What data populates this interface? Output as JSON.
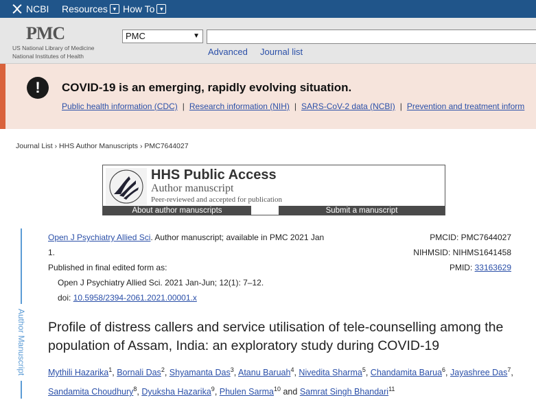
{
  "topbar": {
    "brand": "NCBI",
    "menu_resources": "Resources",
    "menu_howto": "How To"
  },
  "header": {
    "logo": "PMC",
    "nlm_line1": "US National Library of Medicine",
    "nlm_line2": "National Institutes of Health",
    "db_select": "PMC",
    "link_advanced": "Advanced",
    "link_journal_list": "Journal list"
  },
  "alert": {
    "message": "COVID-19 is an emerging, rapidly evolving situation.",
    "links": [
      "Public health information (CDC)",
      "Research information (NIH)",
      "SARS-CoV-2 data (NCBI)",
      "Prevention and treatment inform"
    ]
  },
  "breadcrumb": {
    "item1": "Journal List",
    "item2": "HHS Author Manuscripts",
    "item3": "PMC7644027",
    "sep": "›"
  },
  "hhs": {
    "title": "HHS Public Access",
    "subtitle": "Author manuscript",
    "tagline": "Peer-reviewed and accepted for publication",
    "btn_about": "About author manuscripts",
    "btn_submit": "Submit a manuscript"
  },
  "ribbon": "Author Manuscript",
  "citation": {
    "journal_link": "Open J Psychiatry Allied Sci",
    "line1_rest": ". Author manuscript; available in PMC 2021 Jan",
    "line1_wrap": "1.",
    "published_label": "Published in final edited form as:",
    "published_ref": "Open J Psychiatry Allied Sci. 2021 Jan-Jun; 12(1): 7–12.",
    "doi_label": "doi: ",
    "doi": "10.5958/2394-2061.2021.00001.x"
  },
  "ids": {
    "pmcid": "PMCID: PMC7644027",
    "nihmsid": "NIHMSID: NIHMS1641458",
    "pmid_label": "PMID: ",
    "pmid": "33163629"
  },
  "title": "Profile of distress callers and service utilisation of tele-counselling among the population of Assam, India: an exploratory study during COVID-19",
  "authors": [
    {
      "name": "Mythili Hazarika",
      "sup": "1"
    },
    {
      "name": "Bornali Das",
      "sup": "2"
    },
    {
      "name": "Shyamanta Das",
      "sup": "3"
    },
    {
      "name": "Atanu Baruah",
      "sup": "4"
    },
    {
      "name": "Nivedita Sharma",
      "sup": "5"
    },
    {
      "name": "Chandamita Barua",
      "sup": "6"
    },
    {
      "name": "Jayashree Das",
      "sup": "7"
    },
    {
      "name": "Sandamita Choudhury",
      "sup": "8"
    },
    {
      "name": "Dyuksha Hazarika",
      "sup": "9"
    },
    {
      "name": "Phulen Sarma",
      "sup": "10"
    },
    {
      "name": "Samrat Singh Bhandari",
      "sup": "11"
    }
  ],
  "authors_and": "and"
}
